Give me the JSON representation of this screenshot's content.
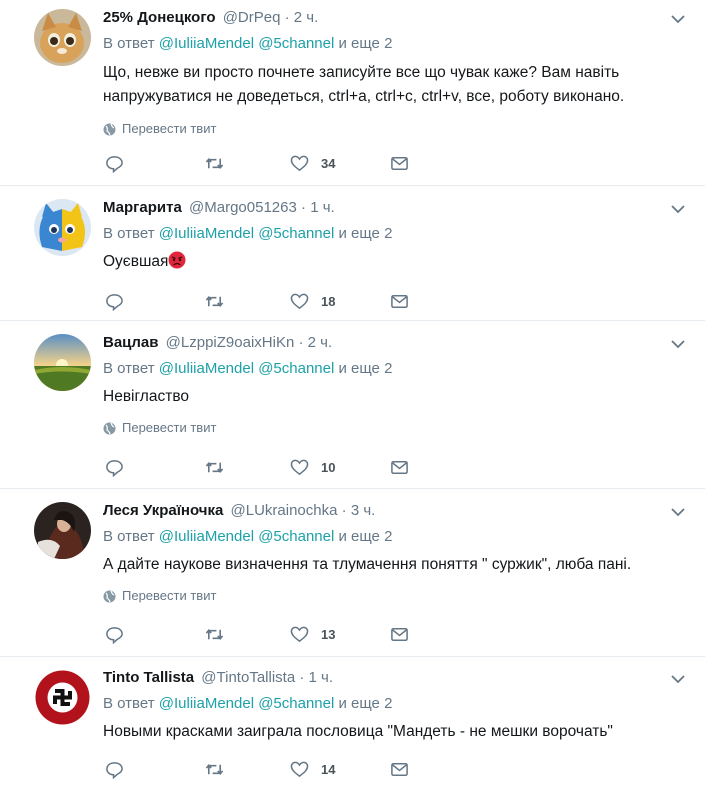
{
  "colors": {
    "accent": "#1da1a8",
    "muted": "#657786",
    "border": "#e6ecf0",
    "text": "#14171a"
  },
  "tweets": [
    {
      "name": "25% Донецкого",
      "handle": "@DrPeq",
      "sep": "·",
      "time": "2 ч.",
      "reply_prefix": "В ответ",
      "mention1": "@IuliiaMendel",
      "mention2": "@5channel",
      "reply_suffix": "и еще 2",
      "text": "Що, невже ви просто почнете записуйте все що чувак каже? Вам навіть напружуватися не доведеться, ctrl+a, ctrl+c, ctrl+v, все, роботу виконано.",
      "translate": "Перевести твит",
      "likes": "34",
      "avatar_icon": "cat-avatar-icon"
    },
    {
      "name": "Маргарита",
      "handle": "@Margo051263",
      "sep": "·",
      "time": "1 ч.",
      "reply_prefix": "В ответ",
      "mention1": "@IuliiaMendel",
      "mention2": "@5channel",
      "reply_suffix": "и еще 2",
      "text": "Оуєвшая",
      "emoji": "angry-face-emoji",
      "likes": "18",
      "avatar_icon": "blue-yellow-cat-avatar-icon"
    },
    {
      "name": "Вацлав",
      "handle": "@LzppiZ9oaixHiKn",
      "sep": "·",
      "time": "2 ч.",
      "reply_prefix": "В ответ",
      "mention1": "@IuliiaMendel",
      "mention2": "@5channel",
      "reply_suffix": "и еще 2",
      "text": "Невігластво",
      "translate": "Перевести твит",
      "likes": "10",
      "avatar_icon": "sunset-field-avatar-icon"
    },
    {
      "name": "Леся Україночка",
      "handle": "@LUkrainochka",
      "sep": "·",
      "time": "3 ч.",
      "reply_prefix": "В ответ",
      "mention1": "@IuliiaMendel",
      "mention2": "@5channel",
      "reply_suffix": "и еще 2",
      "text": "А дайте наукове визначення та тлумачення поняття \" суржик\", люба пані.",
      "translate": "Перевести твит",
      "likes": "13",
      "avatar_icon": "dark-portrait-avatar-icon"
    },
    {
      "name": "Tinto Tallista",
      "handle": "@TintoTallista",
      "sep": "·",
      "time": "1 ч.",
      "reply_prefix": "В ответ",
      "mention1": "@IuliiaMendel",
      "mention2": "@5channel",
      "reply_suffix": "и еще 2",
      "text": "Новыми красками заиграла пословица \"Мандеть - не мешки ворочать\"",
      "likes": "14",
      "avatar_icon": "red-emblem-avatar-icon"
    }
  ]
}
